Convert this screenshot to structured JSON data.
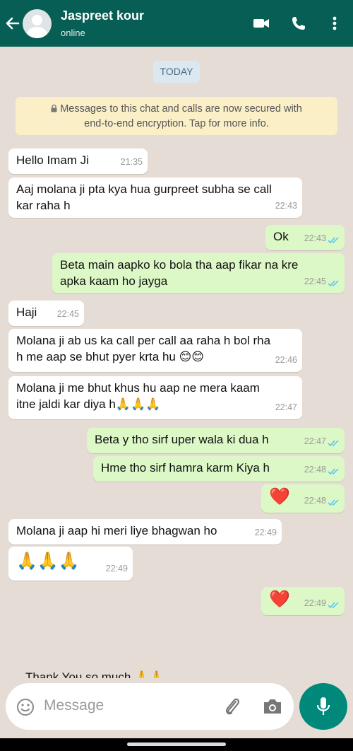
{
  "header": {
    "contact_name": "Jaspreet kour",
    "status": "online"
  },
  "date_chip": "TODAY",
  "encryption_notice": {
    "line1": "Messages to this chat and calls are now secured with",
    "line2": "end-to-end encryption. Tap for more info."
  },
  "messages": [
    {
      "lines": [
        "Hello Imam Ji"
      ],
      "time": "21:35"
    },
    {
      "lines": [
        "Aaj molana ji pta kya hua gurpreet subha se call",
        "kar raha h"
      ],
      "time": "22:43"
    },
    {
      "lines": [
        "Ok"
      ],
      "time": "22:43"
    },
    {
      "lines": [
        "Beta main aapko ko bola tha aap fikar na kre",
        "apka kaam ho jayga"
      ],
      "time": "22:45"
    },
    {
      "lines": [
        "Haji"
      ],
      "time": "22:45"
    },
    {
      "lines": [
        "Molana ji ab us ka call per call aa raha h bol rha",
        "h me aap se bhut pyer krta hu 😊😊"
      ],
      "time": "22:46"
    },
    {
      "lines": [
        "Molana ji me bhut khus hu aap ne mera kaam",
        "itne jaldi kar diya h🙏🙏🙏"
      ],
      "time": "22:47"
    },
    {
      "lines": [
        "Beta y tho sirf uper wala ki dua h"
      ],
      "time": "22:47"
    },
    {
      "lines": [
        "Hme tho sirf hamra karm Kiya h"
      ],
      "time": "22:48"
    },
    {
      "lines": [
        "❤️"
      ],
      "time": "22:48"
    },
    {
      "lines": [
        "Molana ji aap hi meri liye bhagwan ho"
      ],
      "time": "22:49"
    },
    {
      "lines": [
        "🙏🙏🙏"
      ],
      "time": "22:49"
    },
    {
      "lines": [
        "❤️"
      ],
      "time": "22:49"
    }
  ],
  "partial_message": "Thank You so much 🙏🙏",
  "input": {
    "placeholder": "Message"
  },
  "colors": {
    "header": "#075e54",
    "outgoing": "#dcf8c6",
    "incoming": "#ffffff",
    "accent": "#00897b",
    "read_ticks": "#4fc3f7"
  },
  "icons": [
    "back-arrow-icon",
    "video-call-icon",
    "phone-icon",
    "more-vert-icon",
    "emoji-icon",
    "attach-icon",
    "camera-icon",
    "mic-icon",
    "lock-icon",
    "double-check-icon"
  ]
}
